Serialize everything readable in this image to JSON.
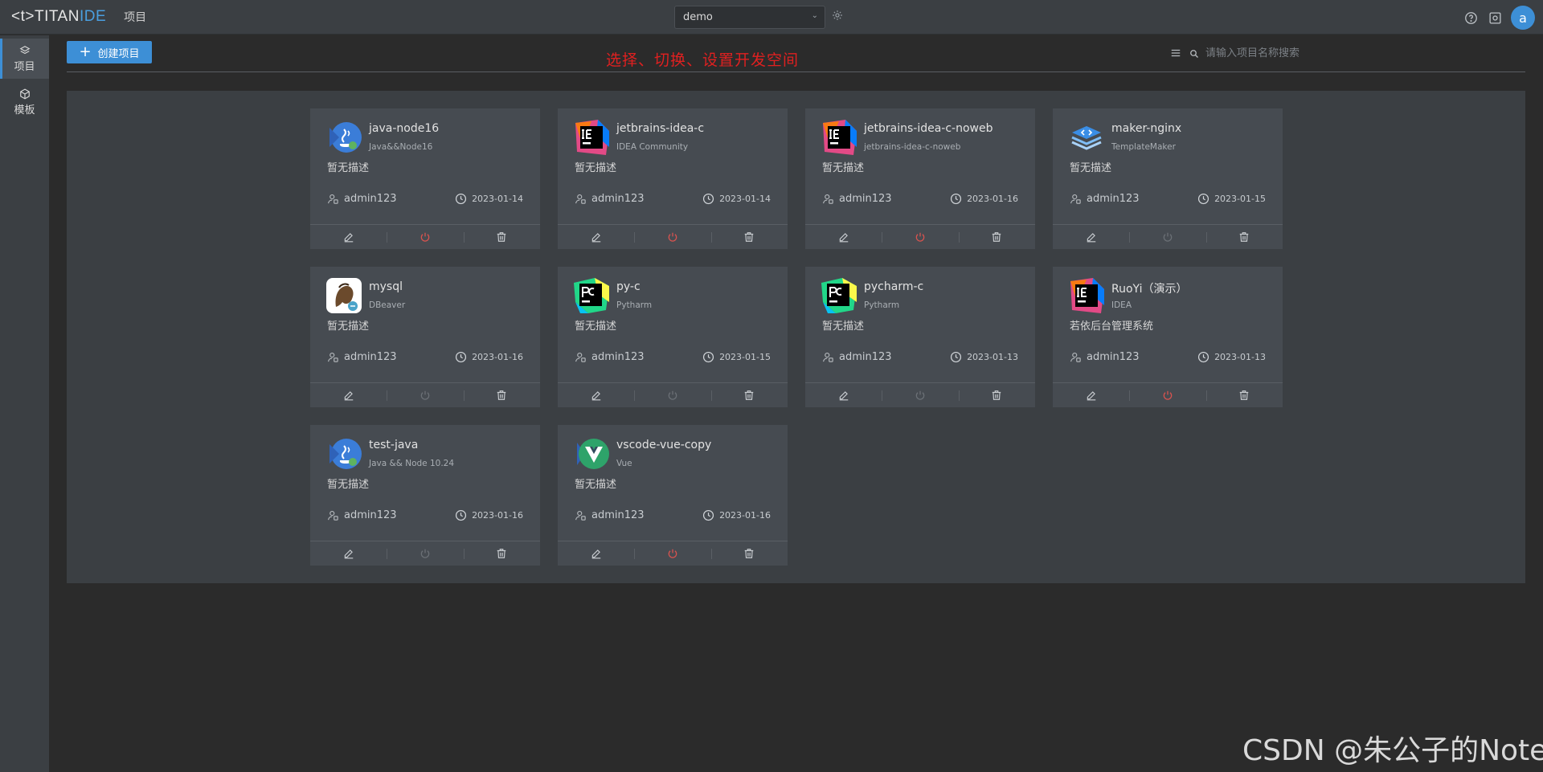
{
  "header": {
    "logo_prefix": "<t>TITAN",
    "logo_suffix": "IDE",
    "nav_label": "项目",
    "workspace_value": "demo"
  },
  "sidebar": {
    "items": [
      {
        "label": "项目",
        "icon": "layers-icon",
        "active": true
      },
      {
        "label": "模板",
        "icon": "cube-icon",
        "active": false
      }
    ]
  },
  "toolbar": {
    "create_label": "创建项目",
    "annotation": "选择、切换、设置开发空间",
    "search_placeholder": "请输入项目名称搜索"
  },
  "projects": [
    {
      "name": "java-node16",
      "template": "Java&&Node16",
      "desc": "暂无描述",
      "owner": "admin123",
      "date": "2023-01-14",
      "logo": "java-icon",
      "running": true
    },
    {
      "name": "jetbrains-idea-c",
      "template": "IDEA Community",
      "desc": "暂无描述",
      "owner": "admin123",
      "date": "2023-01-14",
      "logo": "idea-icon",
      "running": true
    },
    {
      "name": "jetbrains-idea-c-noweb",
      "template": "jetbrains-idea-c-noweb",
      "desc": "暂无描述",
      "owner": "admin123",
      "date": "2023-01-16",
      "logo": "idea-icon",
      "running": true
    },
    {
      "name": "maker-nginx",
      "template": "TemplateMaker",
      "desc": "暂无描述",
      "owner": "admin123",
      "date": "2023-01-15",
      "logo": "maker-icon",
      "running": false
    },
    {
      "name": "mysql",
      "template": "DBeaver",
      "desc": "暂无描述",
      "owner": "admin123",
      "date": "2023-01-16",
      "logo": "dbeaver-icon",
      "running": false
    },
    {
      "name": "py-c",
      "template": "Pytharm",
      "desc": "暂无描述",
      "owner": "admin123",
      "date": "2023-01-15",
      "logo": "pycharm-icon",
      "running": false
    },
    {
      "name": "pycharm-c",
      "template": "Pytharm",
      "desc": "暂无描述",
      "owner": "admin123",
      "date": "2023-01-13",
      "logo": "pycharm-icon",
      "running": false
    },
    {
      "name": "RuoYi（演示）",
      "template": "IDEA",
      "desc": "若依后台管理系统",
      "owner": "admin123",
      "date": "2023-01-13",
      "logo": "idea-icon",
      "running": true
    },
    {
      "name": "test-java",
      "template": "Java && Node 10.24",
      "desc": "暂无描述",
      "owner": "admin123",
      "date": "2023-01-16",
      "logo": "java-icon",
      "running": false
    },
    {
      "name": "vscode-vue-copy",
      "template": "Vue",
      "desc": "暂无描述",
      "owner": "admin123",
      "date": "2023-01-16",
      "logo": "vue-icon",
      "running": true
    }
  ],
  "colors": {
    "accent": "#3d8fd6",
    "running": "#d9534f",
    "stopped": "#6b7076",
    "annotation": "#e02020"
  },
  "watermark": "CSDN @朱公子的Note"
}
